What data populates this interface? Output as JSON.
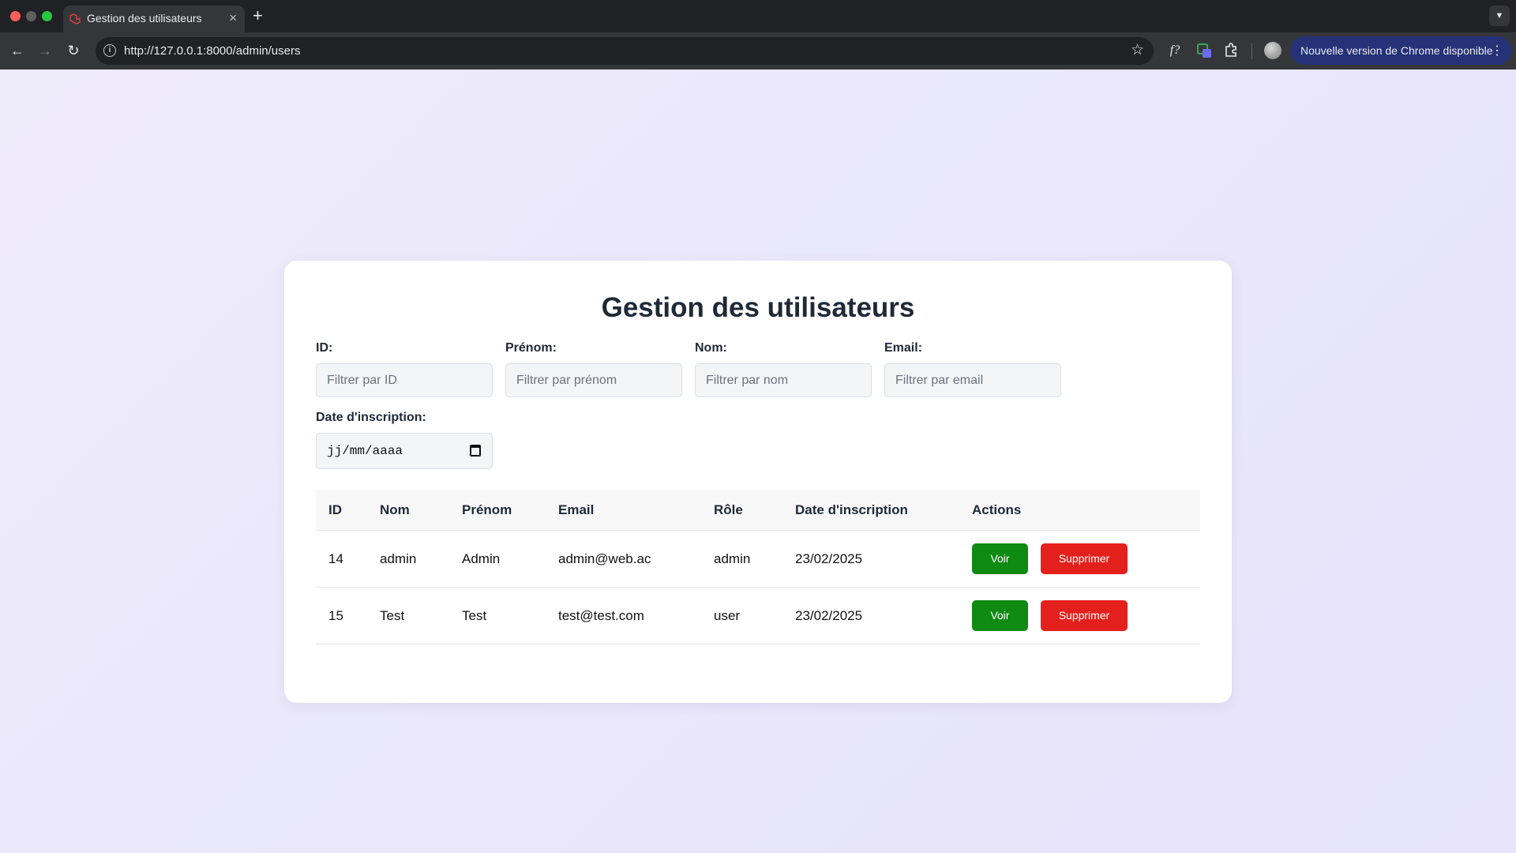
{
  "browser": {
    "tab_title": "Gestion des utilisateurs",
    "tab_close": "×",
    "new_tab": "+",
    "url": "http://127.0.0.1:8000/admin/users",
    "update_label": "Nouvelle version de Chrome disponible",
    "accent_color": "#253278"
  },
  "page": {
    "title": "Gestion des utilisateurs",
    "filters": {
      "id": {
        "label": "ID:",
        "placeholder": "Filtrer par ID"
      },
      "prenom": {
        "label": "Prénom:",
        "placeholder": "Filtrer par prénom"
      },
      "nom": {
        "label": "Nom:",
        "placeholder": "Filtrer par nom"
      },
      "email": {
        "label": "Email:",
        "placeholder": "Filtrer par email"
      },
      "date": {
        "label": "Date d'inscription:",
        "value": "jj/mm/aaaa"
      }
    },
    "table": {
      "headers": [
        "ID",
        "Nom",
        "Prénom",
        "Email",
        "Rôle",
        "Date d'inscription",
        "Actions"
      ],
      "rows": [
        {
          "id": "14",
          "nom": "admin",
          "prenom": "Admin",
          "email": "admin@web.ac",
          "role": "admin",
          "date": "23/02/2025",
          "view_label": "Voir",
          "delete_label": "Supprimer"
        },
        {
          "id": "15",
          "nom": "Test",
          "prenom": "Test",
          "email": "test@test.com",
          "role": "user",
          "date": "23/02/2025",
          "view_label": "Voir",
          "delete_label": "Supprimer"
        }
      ]
    },
    "colors": {
      "view_button": "#0f8a13",
      "delete_button": "#e3201c"
    }
  }
}
